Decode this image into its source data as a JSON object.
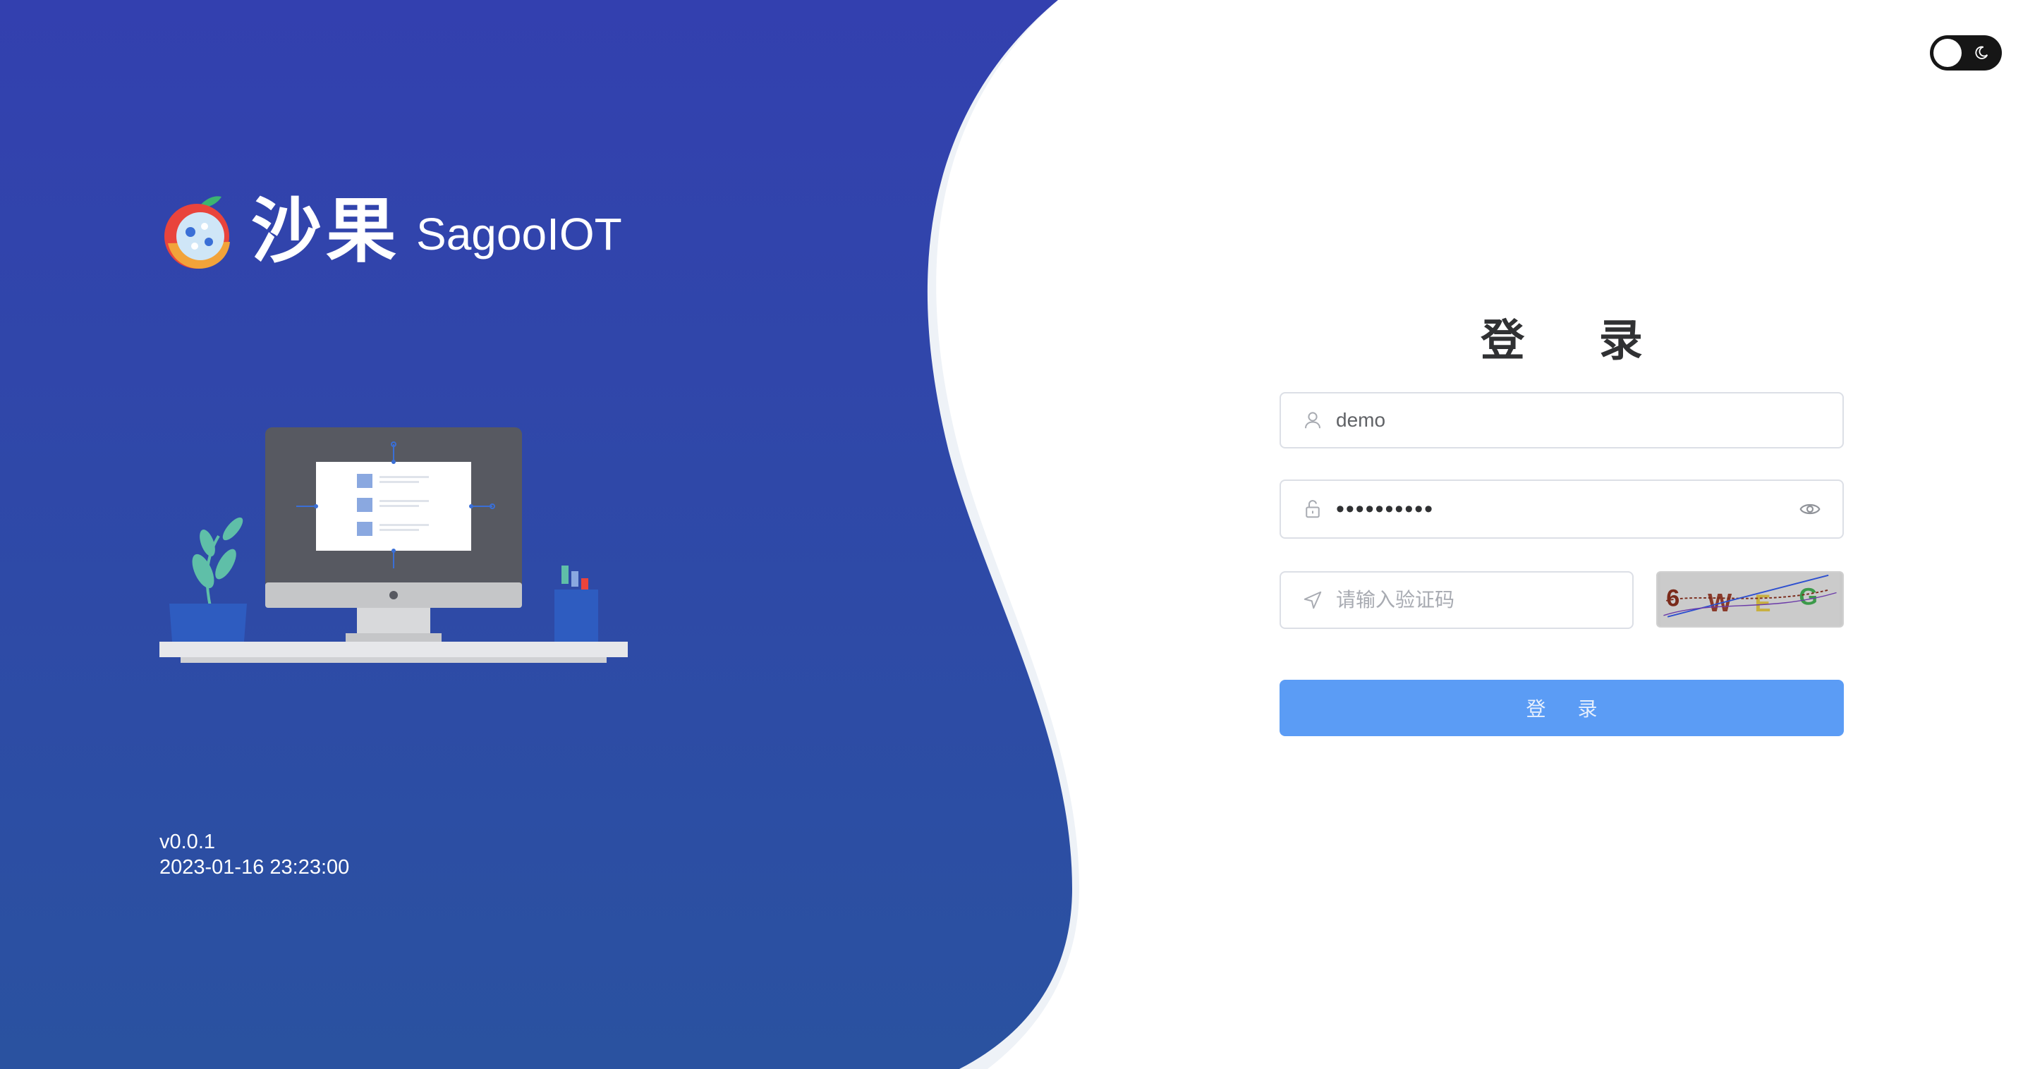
{
  "brand": {
    "name_cn": "沙果",
    "name_en": "SagooIOT"
  },
  "version": {
    "number": "v0.0.1",
    "build_time": "2023-01-16 23:23:00"
  },
  "theme_toggle": {
    "icon": "moon-icon",
    "state": "light"
  },
  "login": {
    "title": "登 录",
    "username": {
      "value": "demo",
      "icon": "user-icon"
    },
    "password": {
      "value": "••••••••••",
      "icon": "lock-icon",
      "toggle_icon": "eye-icon"
    },
    "captcha": {
      "placeholder": "请输入验证码",
      "icon": "send-icon",
      "image_text": "6WEG"
    },
    "submit_label": "登 录"
  },
  "colors": {
    "panel_blue_top": "#3340af",
    "panel_blue_bottom": "#2a4fa0",
    "button_blue": "#5b9cf5",
    "toggle_dark": "#161616"
  }
}
